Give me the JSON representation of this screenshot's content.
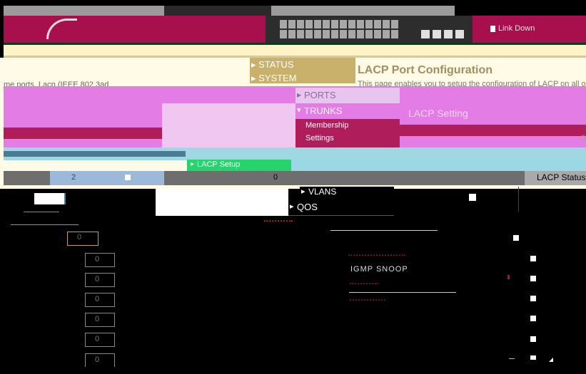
{
  "header": {
    "logo_text": "",
    "legend": {
      "link_down": "Link Down"
    }
  },
  "menu": {
    "status": "STATUS",
    "system": "SYSTEM",
    "ports": "PORTS",
    "trunks": "TRUNKS",
    "membership": "Membership",
    "settings": "Settings",
    "lacp_setup": "LACP Setup",
    "vlans": "VLANS",
    "qos": "QOS",
    "igmp_snoop": "IGMP SNOOP"
  },
  "page": {
    "title": "LACP Port Configuration",
    "description_right": "This page enables you to setup the configuration of LACP on all or so",
    "description_left": "me ports. Lacp (IEEE 802.3ad"
  },
  "lacp": {
    "setting_header": "LACP Setting",
    "status_header": "LACP Status",
    "row_key": "2",
    "row_value": "0",
    "right_value": "0",
    "priority_values": [
      "0",
      "0",
      "0",
      "0",
      "0",
      "0"
    ]
  },
  "colors": {
    "maroon": "#a8104d",
    "pink": "#e278e4",
    "panel_tan": "#c9b06b",
    "green_bar": "#27d36c",
    "cyan": "#5fd3e6"
  }
}
